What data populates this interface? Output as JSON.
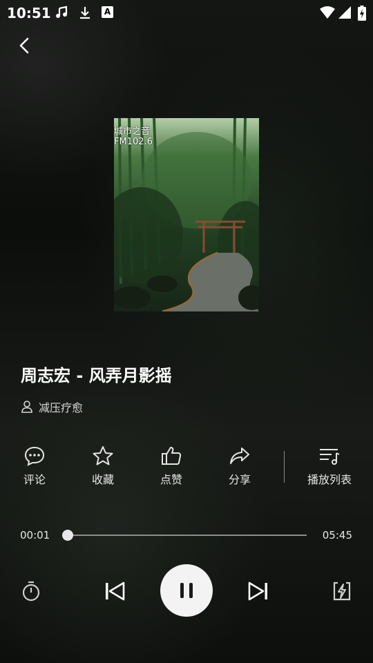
{
  "status_bar": {
    "time": "10:51",
    "app_badge": "A",
    "icons": [
      "music-note-icon",
      "download-icon",
      "app-badge-icon",
      "wifi-icon",
      "signal-icon",
      "battery-charging-icon"
    ]
  },
  "header": {
    "back_icon": "back-arrow-icon"
  },
  "album_art": {
    "overlay_line1": "城市之音",
    "overlay_line2": "FM102.6"
  },
  "song": {
    "title": "周志宏 - 风弄月影摇",
    "artist": "减压疗愈"
  },
  "actions": [
    {
      "icon": "comment-icon",
      "label": "评论"
    },
    {
      "icon": "star-icon",
      "label": "收藏"
    },
    {
      "icon": "thumbs-up-icon",
      "label": "点赞"
    },
    {
      "icon": "share-icon",
      "label": "分享"
    },
    {
      "icon": "playlist-icon",
      "label": "播放列表"
    }
  ],
  "progress": {
    "current": "00:01",
    "total": "05:45",
    "fraction": 0.003
  },
  "controls": {
    "timer_icon": "timer-icon",
    "prev_icon": "skip-previous-icon",
    "play_state": "playing",
    "pause_icon": "pause-icon",
    "next_icon": "skip-next-icon",
    "mode_icon": "power-mode-icon"
  },
  "colors": {
    "background": "#121412",
    "accent": "#ffffff",
    "play_button": "#f3f3f3"
  }
}
